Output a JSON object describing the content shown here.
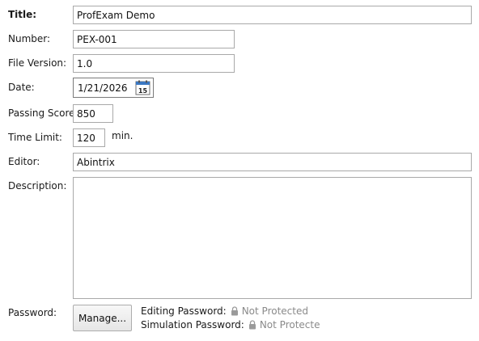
{
  "form": {
    "title": {
      "label": "Title:",
      "value": "ProfExam Demo"
    },
    "number": {
      "label": "Number:",
      "value": "PEX-001"
    },
    "file_version": {
      "label": "File Version:",
      "value": "1.0"
    },
    "date": {
      "label": "Date:",
      "value": "1/21/2026",
      "calendar_icon": "calendar-icon",
      "calendar_day": "15"
    },
    "passing_score": {
      "label": "Passing Score:",
      "value": "850"
    },
    "time_limit": {
      "label": "Time Limit:",
      "value": "120",
      "unit": "min."
    },
    "editor": {
      "label": "Editor:",
      "value": "Abintrix"
    },
    "description": {
      "label": "Description:",
      "value": ""
    },
    "password": {
      "label": "Password:",
      "manage_label": "Manage...",
      "editing_label": "Editing Password:",
      "editing_status": "Not Protected",
      "simulation_label": "Simulation Password:",
      "simulation_status": "Not Protecte",
      "lock_icon": "lock-icon"
    }
  },
  "colors": {
    "field_border": "#a9a9a9",
    "status_text": "#8a8a8a",
    "calendar_accent": "#3a78c3"
  }
}
